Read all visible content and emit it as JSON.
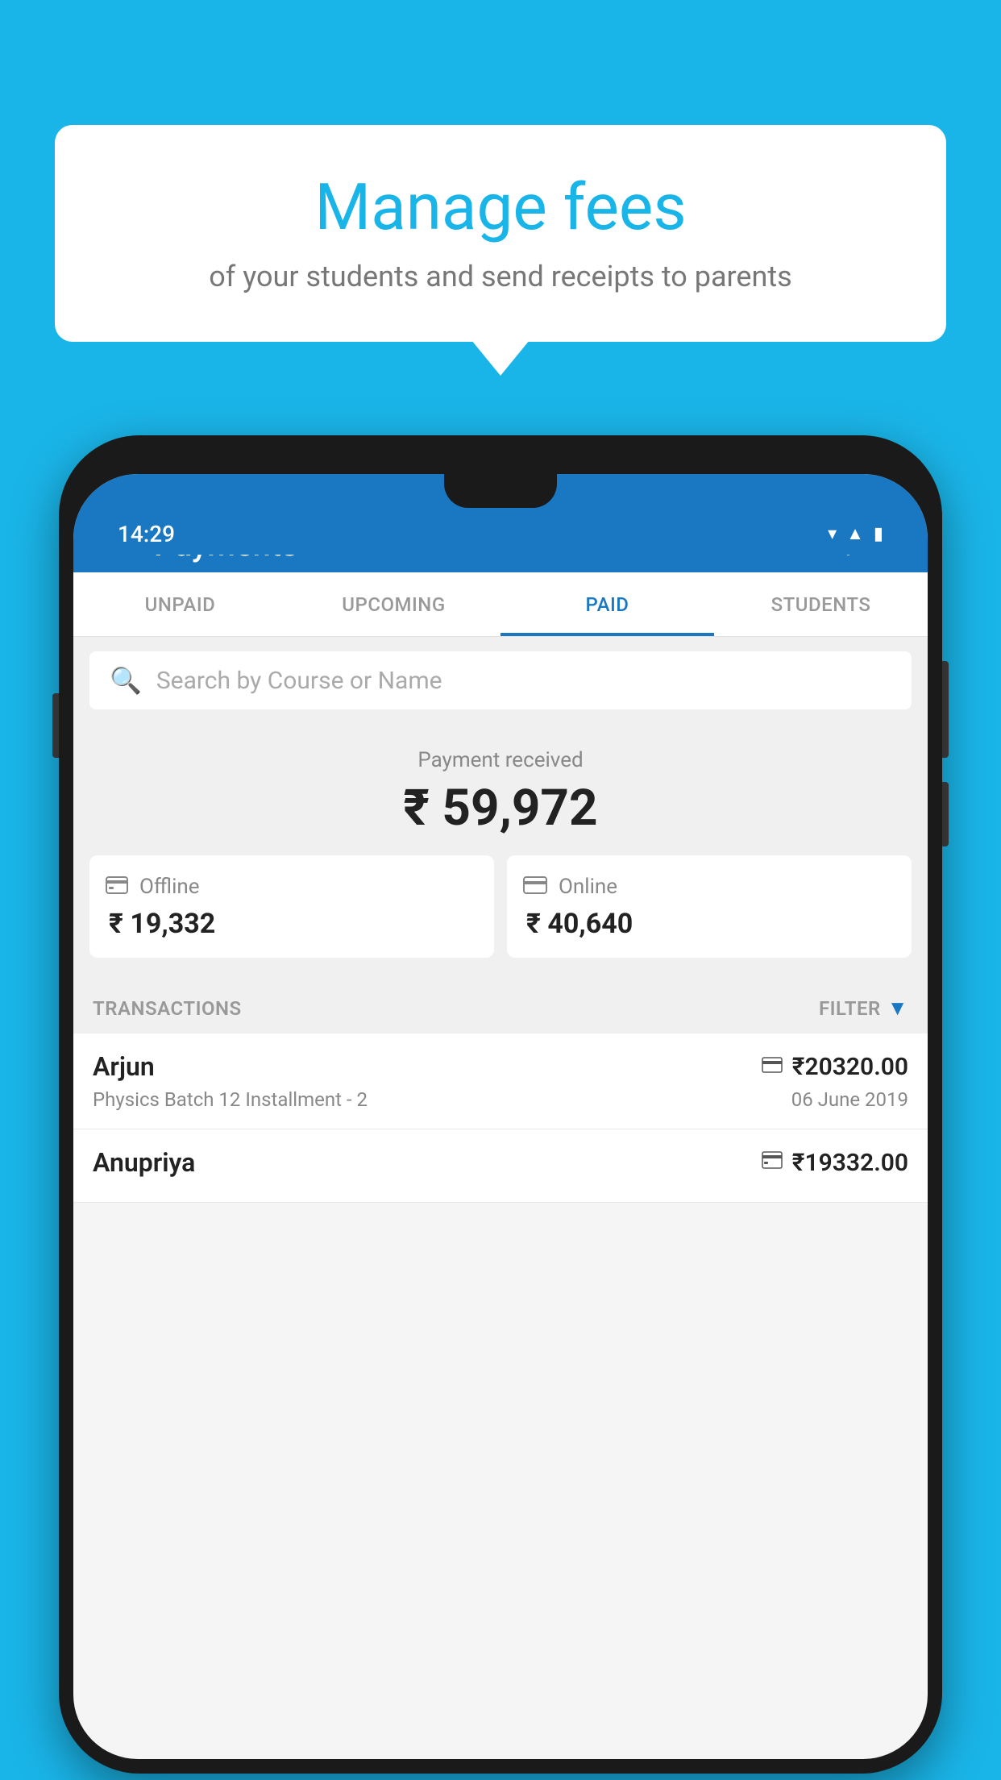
{
  "bubble": {
    "title": "Manage fees",
    "subtitle": "of your students and send receipts to parents"
  },
  "phone": {
    "status": {
      "time": "14:29",
      "icons": [
        "wifi",
        "signal",
        "battery"
      ]
    },
    "app_bar": {
      "title": "Payments",
      "back_label": "←",
      "settings_label": "⚙",
      "add_label": "+"
    },
    "tabs": [
      {
        "label": "UNPAID",
        "active": false
      },
      {
        "label": "UPCOMING",
        "active": false
      },
      {
        "label": "PAID",
        "active": true
      },
      {
        "label": "STUDENTS",
        "active": false
      }
    ],
    "search": {
      "placeholder": "Search by Course or Name"
    },
    "payment_summary": {
      "label": "Payment received",
      "total": "₹ 59,972",
      "offline_label": "Offline",
      "offline_amount": "₹ 19,332",
      "online_label": "Online",
      "online_amount": "₹ 40,640"
    },
    "transactions": {
      "header_label": "TRANSACTIONS",
      "filter_label": "FILTER",
      "items": [
        {
          "name": "Arjun",
          "course": "Physics Batch 12 Installment - 2",
          "amount": "₹20320.00",
          "date": "06 June 2019",
          "payment_type": "online"
        },
        {
          "name": "Anupriya",
          "course": "",
          "amount": "₹19332.00",
          "date": "",
          "payment_type": "offline"
        }
      ]
    }
  },
  "colors": {
    "brand_blue": "#1ab5e8",
    "app_bar_blue": "#1a78c2",
    "accent": "#1a78c2"
  }
}
